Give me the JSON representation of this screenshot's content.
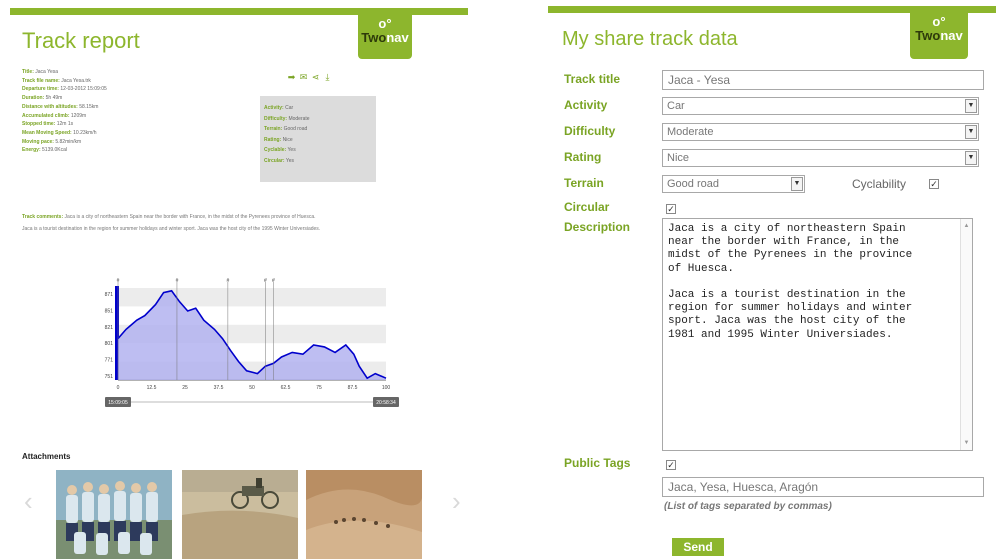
{
  "report": {
    "title": "Track report",
    "logo": {
      "mark": "o°",
      "brand_main": "Two",
      "brand_accent": "nav"
    },
    "meta": [
      {
        "label": "Title:",
        "value": "Jaca Yesa"
      },
      {
        "label": "Track file name:",
        "value": "Jaca Yesa.trk"
      },
      {
        "label": "Departure time:",
        "value": "12-03-2012 15:09:05"
      },
      {
        "label": "Duration:",
        "value": "5h 49m"
      },
      {
        "label": "Distance with altitudes:",
        "value": "58.15km"
      },
      {
        "label": "Accumulated climb:",
        "value": "1209m"
      },
      {
        "label": "Stopped time:",
        "value": "12m 1s"
      },
      {
        "label": "Mean Moving Speed:",
        "value": "10.23km/h"
      },
      {
        "label": "Moving pace:",
        "value": "5.82min/km"
      },
      {
        "label": "Energy:",
        "value": "5139.0Kcal"
      }
    ],
    "info": [
      {
        "label": "Activity:",
        "value": "Car"
      },
      {
        "label": "Difficulty:",
        "value": "Moderate"
      },
      {
        "label": "Terrain:",
        "value": "Good road"
      },
      {
        "label": "Rating:",
        "value": "Nice"
      },
      {
        "label": "Cyclable:",
        "value": "Yes"
      },
      {
        "label": "Circular:",
        "value": "Yes"
      }
    ],
    "comments_label": "Track comments:",
    "comments_p1": "Jaca is a city of northeastern Spain near the border with France, in the midst of the Pyrenees province of Huesca.",
    "comments_p2": "Jaca is a tourist destination in the region for summer holidays and winter sport. Jaca was the host city of the 1995 Winter Universiades.",
    "profile": {
      "y_ticks": [
        "871",
        "851",
        "821",
        "801",
        "771",
        "751"
      ],
      "x_ticks": [
        "0",
        "12.5",
        "25",
        "37.5",
        "50",
        "62.5",
        "75",
        "87.5",
        "100"
      ],
      "start_time": "15:09:05",
      "end_time": "20:58:34",
      "fill_color": "#b3b3f0",
      "line_color": "#0000cc"
    },
    "attachments_title": "Attachments",
    "prev_arrow": "‹",
    "next_arrow": "›",
    "icons": [
      "arrow-icon",
      "email-icon",
      "share-icon",
      "download-icon"
    ]
  },
  "form": {
    "title": "My share track data",
    "logo": {
      "mark": "o°",
      "brand_main": "Two",
      "brand_accent": "nav"
    },
    "labels": {
      "track_title": "Track title",
      "activity": "Activity",
      "difficulty": "Difficulty",
      "rating": "Rating",
      "terrain": "Terrain",
      "cyclability": "Cyclability",
      "circular": "Circular",
      "description": "Description",
      "public_tags": "Public Tags"
    },
    "track_title_value": "Jaca - Yesa",
    "activity_value": "Car",
    "difficulty_value": "Moderate",
    "rating_value": "Nice",
    "terrain_value": "Good road",
    "check_mark": "✓",
    "select_arrow": "▼",
    "description_value": "Jaca is a city of northeastern Spain\nnear the border with France, in the\nmidst of the Pyrenees in the province\nof Huesca.\n\nJaca is a tourist destination in the\nregion for summer holidays and winter\nsport. Jaca was the host city of the\n1981 and 1995 Winter Universiades.",
    "tags_value": "Jaca, Yesa, Huesca, Aragón",
    "tags_hint": "(List of tags separated by commas)",
    "send_label": "Send",
    "accent_color": "#8db62d"
  }
}
